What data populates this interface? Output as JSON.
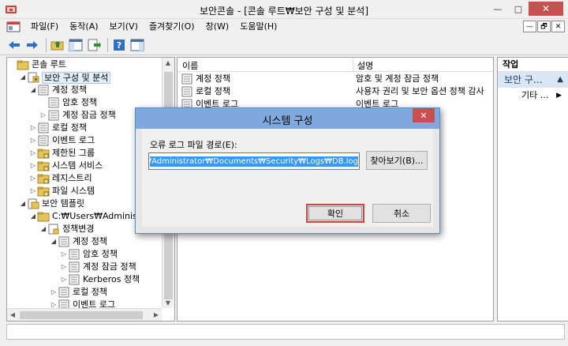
{
  "window": {
    "title": "보안콘솔 - [콘솔 루트₩보안 구성 및 분석]",
    "minimize": "—",
    "maximize": "□",
    "close": "✕"
  },
  "menu": {
    "items": [
      "파일(F)",
      "동작(A)",
      "보기(V)",
      "즐겨찾기(O)",
      "창(W)",
      "도움말(H)"
    ],
    "mdi": [
      "—",
      "🗗",
      "✕"
    ]
  },
  "tree": {
    "items": [
      {
        "label": "콘솔 루트",
        "depth": 0,
        "expander": "",
        "icon": "folder-icon"
      },
      {
        "label": "보안 구성 및 분석",
        "depth": 1,
        "expander": "◢",
        "icon": "security-config-icon",
        "selected": true
      },
      {
        "label": "계정 정책",
        "depth": 2,
        "expander": "◢",
        "icon": "policy-folder-icon"
      },
      {
        "label": "암호 정책",
        "depth": 3,
        "expander": "",
        "icon": "policy-list-icon"
      },
      {
        "label": "계정 잠금 정책",
        "depth": 3,
        "expander": "▷",
        "icon": "policy-list-icon"
      },
      {
        "label": "로컬 정책",
        "depth": 2,
        "expander": "▷",
        "icon": "policy-folder-icon"
      },
      {
        "label": "이벤트 로그",
        "depth": 2,
        "expander": "▷",
        "icon": "policy-list-icon"
      },
      {
        "label": "제한된 그룹",
        "depth": 2,
        "expander": "▷",
        "icon": "folder-lock-icon"
      },
      {
        "label": "시스템 서비스",
        "depth": 2,
        "expander": "▷",
        "icon": "folder-lock-icon"
      },
      {
        "label": "레지스트리",
        "depth": 2,
        "expander": "▷",
        "icon": "folder-lock-icon"
      },
      {
        "label": "파일 시스템",
        "depth": 2,
        "expander": "▷",
        "icon": "folder-lock-icon"
      },
      {
        "label": "보안 템플릿",
        "depth": 1,
        "expander": "◢",
        "icon": "template-icon"
      },
      {
        "label": "C:₩Users₩Administrat",
        "depth": 2,
        "expander": "◢",
        "icon": "folder-icon"
      },
      {
        "label": "정책변경",
        "depth": 3,
        "expander": "◢",
        "icon": "template-file-icon"
      },
      {
        "label": "계정 정책",
        "depth": 4,
        "expander": "◢",
        "icon": "policy-list-icon"
      },
      {
        "label": "암호 정책",
        "depth": 5,
        "expander": "▷",
        "icon": "policy-list-icon"
      },
      {
        "label": "계정 잠금 정책",
        "depth": 5,
        "expander": "▷",
        "icon": "policy-list-icon"
      },
      {
        "label": "Kerberos 정책",
        "depth": 5,
        "expander": "▷",
        "icon": "policy-list-icon"
      },
      {
        "label": "로컬 정책",
        "depth": 4,
        "expander": "▷",
        "icon": "policy-list-icon"
      },
      {
        "label": "이벤트 로그",
        "depth": 4,
        "expander": "▷",
        "icon": "policy-list-icon"
      }
    ]
  },
  "list": {
    "columns": [
      "이름",
      "설명"
    ],
    "rows": [
      {
        "name": "계정 정책",
        "desc": "암호 및 계정 잠금 정책"
      },
      {
        "name": "로컬 정책",
        "desc": "사용자 권리 및 보안 옵션 정책 감사"
      },
      {
        "name": "이벤트 로그",
        "desc": "이벤트 로그"
      }
    ]
  },
  "actions": {
    "header": "작업",
    "section": "보안 구...",
    "collapse": "▲",
    "more": "기타 ...",
    "more_arrow": "▶"
  },
  "dialog": {
    "title": "시스템 구성",
    "close": "✕",
    "label": "오류 로그 파일 경로(E):",
    "path_value": "C:₩Users₩Administrator₩Documents₩Security₩Logs₩DB.log",
    "browse": "찾아보기(B)...",
    "ok": "확인",
    "cancel": "취소"
  },
  "colors": {
    "dialog_title": "#7fa9dc",
    "close_red": "#c75050",
    "selection_blue": "#3399ff"
  }
}
